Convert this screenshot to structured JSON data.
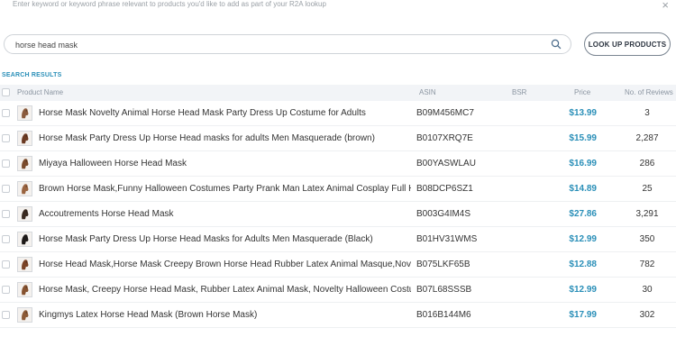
{
  "header": {
    "hint": "Enter keyword or keyword phrase relevant to products you'd like to add as part of your R2A lookup",
    "close_glyph": "×"
  },
  "search": {
    "value": "horse head mask",
    "button_label": "LOOK UP PRODUCTS"
  },
  "results": {
    "label": "SEARCH RESULTS",
    "columns": {
      "name": "Product Name",
      "asin": "ASIN",
      "bsr": "BSR",
      "price": "Price",
      "reviews": "No. of Reviews"
    },
    "rows": [
      {
        "name": "Horse Mask Novelty Animal Horse Head Mask Party Dress Up Costume for Adults",
        "asin": "B09M456MC7",
        "bsr": "",
        "price": "$13.99",
        "reviews": "3",
        "thumb_color": "#8a5a3c"
      },
      {
        "name": "Horse Mask Party Dress Up Horse Head masks for adults Men Masquerade (brown)",
        "asin": "B0107XRQ7E",
        "bsr": "",
        "price": "$15.99",
        "reviews": "2,287",
        "thumb_color": "#6b3a22"
      },
      {
        "name": "Miyaya Halloween Horse Head Mask",
        "asin": "B00YASWLAU",
        "bsr": "",
        "price": "$16.99",
        "reviews": "286",
        "thumb_color": "#7a4a2b"
      },
      {
        "name": "Brown Horse Mask,Funny Halloween Costumes Party Prank Man Latex Animal Cosplay Full Head",
        "asin": "B08DCP6SZ1",
        "bsr": "",
        "price": "$14.89",
        "reviews": "25",
        "thumb_color": "#9a6440"
      },
      {
        "name": "Accoutrements Horse Head Mask",
        "asin": "B003G4IM4S",
        "bsr": "",
        "price": "$27.86",
        "reviews": "3,291",
        "thumb_color": "#3a2a20"
      },
      {
        "name": "Horse Mask Party Dress Up Horse Head Masks for Adults Men Masquerade (Black)",
        "asin": "B01HV31WMS",
        "bsr": "",
        "price": "$12.99",
        "reviews": "350",
        "thumb_color": "#1e1a18"
      },
      {
        "name": "Horse Head Mask,Horse Mask Creepy Brown Horse Head Rubber Latex Animal Masque,Novelty",
        "asin": "B075LKF65B",
        "bsr": "",
        "price": "$12.88",
        "reviews": "782",
        "thumb_color": "#7b4326"
      },
      {
        "name": "Horse Mask, Creepy Horse Head Mask, Rubber Latex Animal Mask, Novelty Halloween Costume",
        "asin": "B07L68SSSB",
        "bsr": "",
        "price": "$12.99",
        "reviews": "30",
        "thumb_color": "#86522f"
      },
      {
        "name": "Kingmys Latex Horse Head Mask (Brown Horse Mask)",
        "asin": "B016B144M6",
        "bsr": "",
        "price": "$17.99",
        "reviews": "302",
        "thumb_color": "#8c5a36"
      }
    ]
  },
  "colors": {
    "accent": "#2a8fb8",
    "header_bg": "#f2f4f7"
  }
}
